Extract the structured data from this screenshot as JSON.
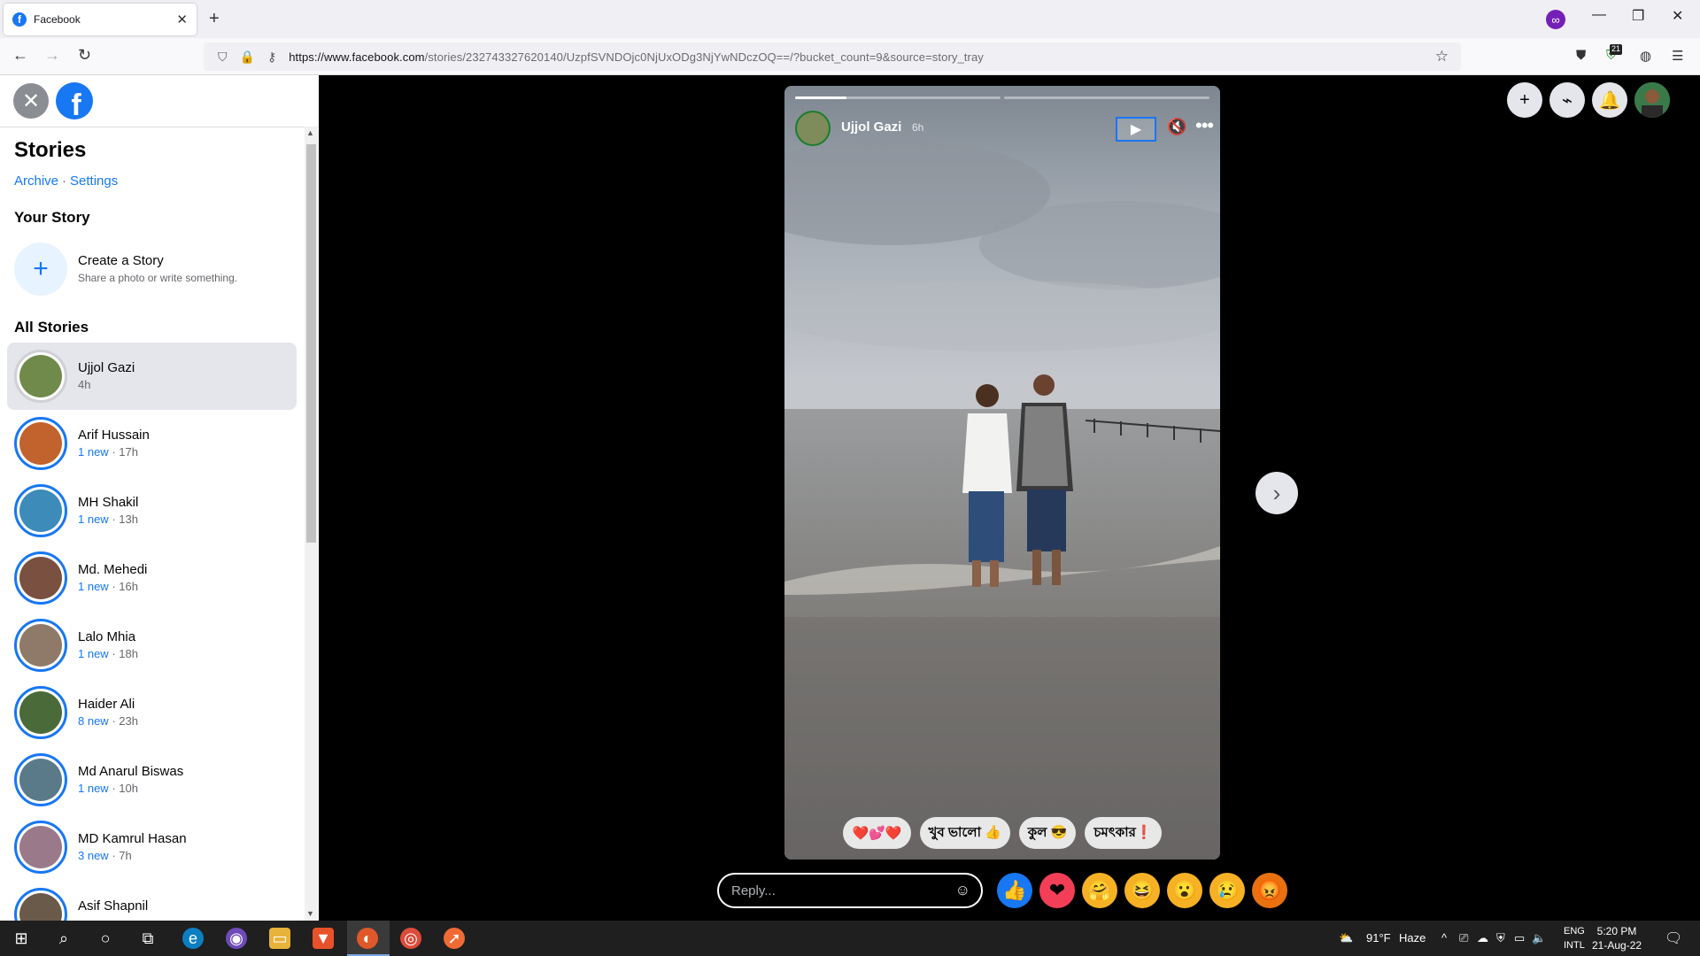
{
  "browser": {
    "tab_title": "Facebook",
    "url_domain": "https://www.facebook.com",
    "url_path": "/stories/232743327620140/UzpfSVNDOjc0NjUxODg3NjYwNDczOQ==/?bucket_count=9&source=story_tray",
    "extension_badge": "21"
  },
  "left_panel": {
    "heading": "Stories",
    "archive_link": "Archive",
    "settings_link": "Settings",
    "your_story_heading": "Your Story",
    "create_title": "Create a Story",
    "create_subtitle": "Share a photo or write something.",
    "all_stories_heading": "All Stories",
    "stories": [
      {
        "name": "Ujjol Gazi",
        "new": "",
        "time": "4h",
        "color": "#6f8a4a"
      },
      {
        "name": "Arif Hussain",
        "new": "1 new",
        "time": "17h",
        "color": "#c2622d"
      },
      {
        "name": "MH Shakil",
        "new": "1 new",
        "time": "13h",
        "color": "#3c8bb8"
      },
      {
        "name": "Md. Mehedi",
        "new": "1 new",
        "time": "16h",
        "color": "#7a5040"
      },
      {
        "name": "Lalo Mhia",
        "new": "1 new",
        "time": "18h",
        "color": "#8f7a6a"
      },
      {
        "name": "Haider Ali",
        "new": "8 new",
        "time": "23h",
        "color": "#4a6a3a"
      },
      {
        "name": "Md Anarul Biswas",
        "new": "1 new",
        "time": "10h",
        "color": "#5a7a8a"
      },
      {
        "name": "MD Kamrul Hasan",
        "new": "3 new",
        "time": "7h",
        "color": "#9a7a8a"
      },
      {
        "name": "Asif Shapnil",
        "new": "",
        "time": "",
        "color": "#6a5a4a"
      }
    ]
  },
  "story": {
    "author": "Ujjol Gazi",
    "time": "6h",
    "progress": [
      0.25,
      0
    ],
    "quick_replies": [
      "❤️💕❤️",
      "খুব ভালো 👍",
      "কুল 😎",
      "চমৎকার❗"
    ],
    "reply_placeholder": "Reply...",
    "reactions": [
      {
        "icon": "like-icon",
        "glyph": "👍",
        "bg": "#1877f2"
      },
      {
        "icon": "love-icon",
        "glyph": "❤",
        "bg": "#f33e58"
      },
      {
        "icon": "care-icon",
        "glyph": "🤗",
        "bg": "#f7b125"
      },
      {
        "icon": "haha-icon",
        "glyph": "😆",
        "bg": "#f7b125"
      },
      {
        "icon": "wow-icon",
        "glyph": "😮",
        "bg": "#f7b125"
      },
      {
        "icon": "sad-icon",
        "glyph": "😢",
        "bg": "#f7b125"
      },
      {
        "icon": "angry-icon",
        "glyph": "😡",
        "bg": "#e9710f"
      }
    ]
  },
  "taskbar": {
    "weather_temp": "91°F",
    "weather_desc": "Haze",
    "lang_1": "ENG",
    "lang_2": "INTL",
    "time": "5:20 PM",
    "date": "21-Aug-22"
  }
}
